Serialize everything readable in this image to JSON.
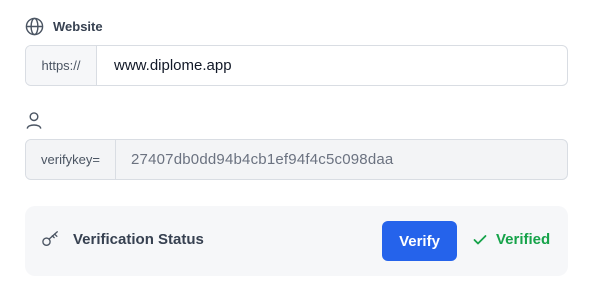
{
  "website": {
    "label": "Website",
    "icon": "globe-icon",
    "prefix": "https://",
    "value": "www.diplome.app"
  },
  "verify_key": {
    "label": "",
    "icon": "user-icon",
    "prefix": "verifykey=",
    "value": "27407db0dd94b4cb1ef94f4c5c098daa"
  },
  "status": {
    "icon": "key-icon",
    "title": "Verification Status",
    "button_label": "Verify",
    "result_icon": "checkmark-icon",
    "result_text": "Verified",
    "colors": {
      "button": "#2563eb",
      "verified": "#16a34a"
    }
  }
}
